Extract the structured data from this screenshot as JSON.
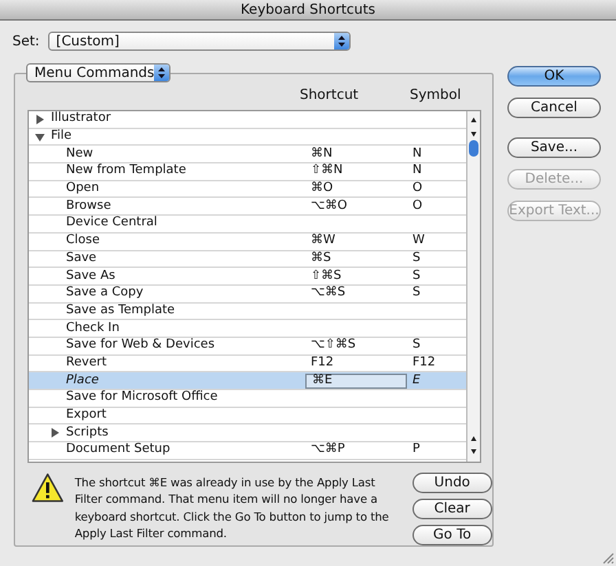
{
  "window": {
    "title": "Keyboard Shortcuts"
  },
  "set": {
    "label": "Set:",
    "value": "[Custom]"
  },
  "category": {
    "value": "Menu Commands"
  },
  "columns": [
    "Shortcut",
    "Symbol"
  ],
  "rows": [
    {
      "kind": "group",
      "name": "Illustrator",
      "expanded": false,
      "selected": false
    },
    {
      "kind": "group",
      "name": "File",
      "expanded": true,
      "selected": false,
      "children": [
        {
          "kind": "command",
          "name": "New",
          "shortcut": "⌘N",
          "symbol": "N",
          "selected": false
        },
        {
          "kind": "command",
          "name": "New from Template",
          "shortcut": "⇧⌘N",
          "symbol": "N",
          "selected": false
        },
        {
          "kind": "command",
          "name": "Open",
          "shortcut": "⌘O",
          "symbol": "O",
          "selected": false
        },
        {
          "kind": "command",
          "name": "Browse",
          "shortcut": "⌥⌘O",
          "symbol": "O",
          "selected": false
        },
        {
          "kind": "command",
          "name": "Device Central",
          "selected": false
        },
        {
          "kind": "command",
          "name": "Close",
          "shortcut": "⌘W",
          "symbol": "W",
          "selected": false
        },
        {
          "kind": "command",
          "name": "Save",
          "shortcut": "⌘S",
          "symbol": "S",
          "selected": false
        },
        {
          "kind": "command",
          "name": "Save As",
          "shortcut": "⇧⌘S",
          "symbol": "S",
          "selected": false
        },
        {
          "kind": "command",
          "name": "Save a Copy",
          "shortcut": "⌥⌘S",
          "symbol": "S",
          "selected": false
        },
        {
          "kind": "command",
          "name": "Save as Template",
          "selected": false
        },
        {
          "kind": "command",
          "name": "Check In",
          "selected": false
        },
        {
          "kind": "command",
          "name": "Save for Web & Devices",
          "shortcut": "⌥⇧⌘S",
          "symbol": "S",
          "selected": false
        },
        {
          "kind": "command",
          "name": "Revert",
          "shortcut": "F12",
          "symbol": "F12",
          "selected": false
        },
        {
          "kind": "command",
          "name": "Place",
          "shortcut": "⌘E",
          "symbol": "E",
          "selected": true
        },
        {
          "kind": "command",
          "name": "Save for Microsoft Office",
          "selected": false
        },
        {
          "kind": "command",
          "name": "Export",
          "selected": false
        },
        {
          "kind": "group",
          "name": "Scripts",
          "expanded": false,
          "selected": false
        },
        {
          "kind": "command",
          "name": "Document Setup",
          "shortcut": "⌥⌘P",
          "symbol": "P",
          "selected": false
        }
      ]
    }
  ],
  "side_buttons": [
    {
      "label": "OK",
      "default": true,
      "disabled": false
    },
    {
      "label": "Cancel",
      "default": false,
      "disabled": false
    },
    {
      "label": "Save...",
      "default": false,
      "disabled": false
    },
    {
      "label": "Delete...",
      "default": false,
      "disabled": true
    },
    {
      "label": "Export Text...",
      "default": false,
      "disabled": true
    }
  ],
  "warning": {
    "message": "The shortcut ⌘E was already in use by the Apply Last Filter command.  That menu item will no longer have a keyboard shortcut. Click the Go To button to jump to the Apply Last Filter command.",
    "buttons": [
      "Undo",
      "Clear",
      "Go To"
    ]
  }
}
